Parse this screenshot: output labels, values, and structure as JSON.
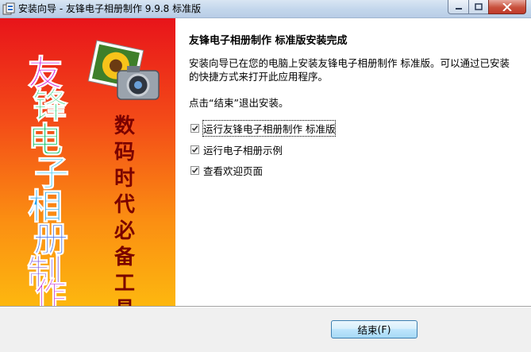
{
  "window": {
    "title": "安装向导 - 友锋电子相册制作 9.9.8 标准版",
    "app_icon": "installer-icon"
  },
  "sidebar": {
    "brand_chars": [
      "友",
      "锋",
      "电",
      "子",
      "相",
      "册",
      "制",
      "作"
    ],
    "slogan": "数码时代必备工具",
    "artwork": "camera-with-sunflower-photo"
  },
  "content": {
    "heading": "友锋电子相册制作  标准版安装完成",
    "description": "安装向导已在您的电脑上安装友锋电子相册制作  标准版。可以通过已安装的快捷方式来打开此应用程序。",
    "exit_hint": "点击“结束”退出安装。",
    "options": [
      {
        "label": "运行友锋电子相册制作  标准版",
        "checked": true
      },
      {
        "label": "运行电子相册示例",
        "checked": true
      },
      {
        "label": "查看欢迎页面",
        "checked": true
      }
    ]
  },
  "footer": {
    "finish_label": "结束",
    "finish_accesskey": "(F)"
  }
}
